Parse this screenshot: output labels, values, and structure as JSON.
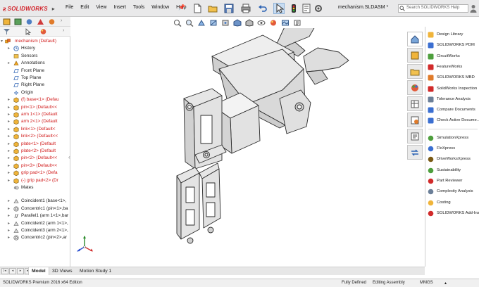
{
  "app": {
    "brand": "SOLIDWORKS",
    "menus": [
      "File",
      "Edit",
      "View",
      "Insert",
      "Tools",
      "Window",
      "Help"
    ],
    "document_title": "mechanism.SLDASM *",
    "search_placeholder": "Search SOLIDWORKS Help"
  },
  "feature_tree": {
    "root": "mechanism  (Default)",
    "items": [
      {
        "label": "History",
        "color": "normal",
        "expand": true,
        "icon": "history-icon"
      },
      {
        "label": "Sensors",
        "color": "normal",
        "expand": false,
        "icon": "sensor-icon"
      },
      {
        "label": "Annotations",
        "color": "normal",
        "expand": true,
        "icon": "annotation-icon"
      },
      {
        "label": "Front Plane",
        "color": "normal",
        "expand": false,
        "icon": "plane-icon"
      },
      {
        "label": "Top Plane",
        "color": "normal",
        "expand": false,
        "icon": "plane-icon"
      },
      {
        "label": "Right Plane",
        "color": "normal",
        "expand": false,
        "icon": "plane-icon"
      },
      {
        "label": "Origin",
        "color": "normal",
        "expand": false,
        "icon": "origin-icon"
      },
      {
        "label": "(f) base<1> (Defau",
        "color": "red",
        "expand": true,
        "icon": "part-icon"
      },
      {
        "label": "pin<1> (Default<<",
        "color": "red",
        "expand": true,
        "icon": "part-icon"
      },
      {
        "label": "arm 1<1> (Default",
        "color": "red",
        "expand": true,
        "icon": "part-icon"
      },
      {
        "label": "arm 2<1> (Default",
        "color": "red",
        "expand": true,
        "icon": "part-icon"
      },
      {
        "label": "link<1> (Default<",
        "color": "red",
        "expand": true,
        "icon": "part-icon"
      },
      {
        "label": "link<2> (Default<<",
        "color": "red",
        "expand": true,
        "icon": "part-icon"
      },
      {
        "label": "plate<1> (Default",
        "color": "red",
        "expand": true,
        "icon": "part-icon"
      },
      {
        "label": "plate<2> (Default",
        "color": "red",
        "expand": true,
        "icon": "part-icon"
      },
      {
        "label": "pin<2> (Default<<",
        "color": "red",
        "expand": true,
        "icon": "part-icon"
      },
      {
        "label": "pin<3> (Default<<",
        "color": "red",
        "expand": true,
        "icon": "part-icon"
      },
      {
        "label": "grip pad<1> (Defa",
        "color": "red",
        "expand": true,
        "icon": "part-icon"
      },
      {
        "label": "(-) grip pad<2> (Dr",
        "color": "red",
        "expand": true,
        "icon": "part-icon"
      },
      {
        "label": "Mates",
        "color": "normal",
        "expand": false,
        "icon": "mates-icon"
      }
    ],
    "mates": [
      {
        "label": "Coincident1 (base<1>,",
        "icon": "coincident-icon"
      },
      {
        "label": "Concentric1 (pin<1>,ba",
        "icon": "concentric-icon"
      },
      {
        "label": "Parallel1 (arm 1<1>,bar",
        "icon": "parallel-icon"
      },
      {
        "label": "Coincident2 (arm 1<1>,",
        "icon": "coincident-icon"
      },
      {
        "label": "Coincident3 (arm 2<1>,",
        "icon": "coincident-icon"
      },
      {
        "label": "Concentric2 (pin<2>,ar",
        "icon": "concentric-icon"
      }
    ]
  },
  "bottom_tabs": [
    "Model",
    "3D Views",
    "Motion Study 1"
  ],
  "status": {
    "edition": "SOLIDWORKS Premium 2016 x64 Edition",
    "definition": "Fully Defined",
    "mode": "Editing Assembly",
    "units": "MMGS"
  },
  "task_pane": {
    "group1": [
      "Design Library",
      "SOLIDWORKS PDM",
      "CircuitWorks",
      "FeatureWorks",
      "SOLIDWORKS MBD",
      "SolidWorks Inspection",
      "Tolerance Analysis",
      "Compare Documents",
      "Check Active Docume..."
    ],
    "group2": [
      "SimulationXpress",
      "FloXpress",
      "DriveWorksXpress",
      "Sustainability",
      "Part Reviewer",
      "Complexity Analysis",
      "Costing",
      "SOLIDWORKS Add-Ins"
    ]
  },
  "colors": {
    "brand_red": "#d2232a",
    "tree_error_red": "#d11b1b",
    "selection_blue": "#c7dcf2"
  }
}
